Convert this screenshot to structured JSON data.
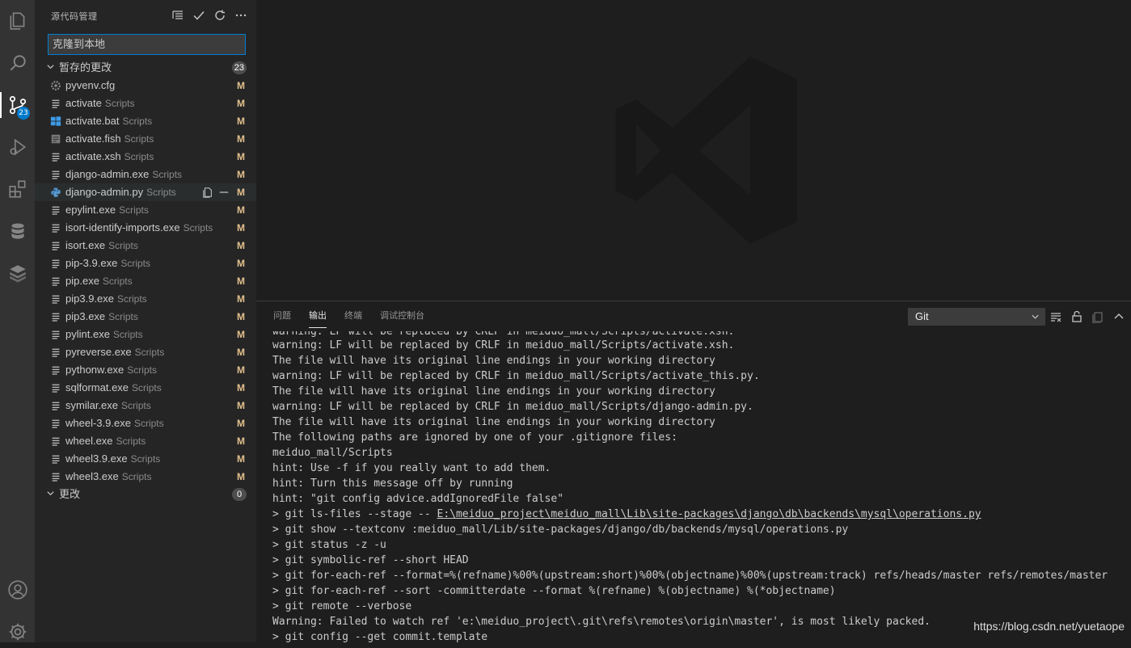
{
  "activity_bar": {
    "items": [
      {
        "name": "explorer-icon"
      },
      {
        "name": "search-icon"
      },
      {
        "name": "source-control-icon",
        "badge": "23"
      },
      {
        "name": "run-debug-icon"
      },
      {
        "name": "extensions-icon"
      },
      {
        "name": "database-icon"
      },
      {
        "name": "layers-icon"
      }
    ],
    "bottom": [
      {
        "name": "account-icon"
      },
      {
        "name": "settings-gear-icon"
      }
    ]
  },
  "sidebar": {
    "title": "源代码管理",
    "commit_message": "克隆到本地",
    "staged_section": {
      "label": "暂存的更改",
      "count": "23"
    },
    "staged_files": [
      {
        "name": "pyvenv.cfg",
        "dir": "",
        "status": "M",
        "icon": "gear"
      },
      {
        "name": "activate",
        "dir": "Scripts",
        "status": "M",
        "icon": "lines"
      },
      {
        "name": "activate.bat",
        "dir": "Scripts",
        "status": "M",
        "icon": "windows"
      },
      {
        "name": "activate.fish",
        "dir": "Scripts",
        "status": "M",
        "icon": "doc"
      },
      {
        "name": "activate.xsh",
        "dir": "Scripts",
        "status": "M",
        "icon": "lines"
      },
      {
        "name": "django-admin.exe",
        "dir": "Scripts",
        "status": "M",
        "icon": "lines"
      },
      {
        "name": "django-admin.py",
        "dir": "Scripts",
        "status": "M",
        "icon": "python"
      },
      {
        "name": "epylint.exe",
        "dir": "Scripts",
        "status": "M",
        "icon": "lines"
      },
      {
        "name": "isort-identify-imports.exe",
        "dir": "Scripts",
        "status": "M",
        "icon": "lines"
      },
      {
        "name": "isort.exe",
        "dir": "Scripts",
        "status": "M",
        "icon": "lines"
      },
      {
        "name": "pip-3.9.exe",
        "dir": "Scripts",
        "status": "M",
        "icon": "lines"
      },
      {
        "name": "pip.exe",
        "dir": "Scripts",
        "status": "M",
        "icon": "lines"
      },
      {
        "name": "pip3.9.exe",
        "dir": "Scripts",
        "status": "M",
        "icon": "lines"
      },
      {
        "name": "pip3.exe",
        "dir": "Scripts",
        "status": "M",
        "icon": "lines"
      },
      {
        "name": "pylint.exe",
        "dir": "Scripts",
        "status": "M",
        "icon": "lines"
      },
      {
        "name": "pyreverse.exe",
        "dir": "Scripts",
        "status": "M",
        "icon": "lines"
      },
      {
        "name": "pythonw.exe",
        "dir": "Scripts",
        "status": "M",
        "icon": "lines"
      },
      {
        "name": "sqlformat.exe",
        "dir": "Scripts",
        "status": "M",
        "icon": "lines"
      },
      {
        "name": "symilar.exe",
        "dir": "Scripts",
        "status": "M",
        "icon": "lines"
      },
      {
        "name": "wheel-3.9.exe",
        "dir": "Scripts",
        "status": "M",
        "icon": "lines"
      },
      {
        "name": "wheel.exe",
        "dir": "Scripts",
        "status": "M",
        "icon": "lines"
      },
      {
        "name": "wheel3.9.exe",
        "dir": "Scripts",
        "status": "M",
        "icon": "lines"
      },
      {
        "name": "wheel3.exe",
        "dir": "Scripts",
        "status": "M",
        "icon": "lines"
      }
    ],
    "hovered_index": 6,
    "changes_section": {
      "label": "更改",
      "count": "0"
    }
  },
  "panel": {
    "tabs": [
      "问题",
      "输出",
      "终端",
      "调试控制台"
    ],
    "active_tab": 1,
    "channel": "Git",
    "output_lines": [
      {
        "text": "warning: LF will be replaced by CRLF in meiduo_mall/Scripts/activate.xsh.",
        "cut": true
      },
      {
        "text": "warning: LF will be replaced by CRLF in meiduo_mall/Scripts/activate.xsh."
      },
      {
        "text": "The file will have its original line endings in your working directory"
      },
      {
        "text": "warning: LF will be replaced by CRLF in meiduo_mall/Scripts/activate_this.py."
      },
      {
        "text": "The file will have its original line endings in your working directory"
      },
      {
        "text": "warning: LF will be replaced by CRLF in meiduo_mall/Scripts/django-admin.py."
      },
      {
        "text": "The file will have its original line endings in your working directory"
      },
      {
        "text": "The following paths are ignored by one of your .gitignore files:"
      },
      {
        "text": "meiduo_mall/Scripts"
      },
      {
        "text": "hint: Use -f if you really want to add them."
      },
      {
        "text": "hint: Turn this message off by running"
      },
      {
        "text": "hint: \"git config advice.addIgnoredFile false\""
      },
      {
        "text": "> git ls-files --stage -- ",
        "link": "E:\\meiduo_project\\meiduo_mall\\Lib\\site-packages\\django\\db\\backends\\mysql\\operations.py"
      },
      {
        "text": "> git show --textconv :meiduo_mall/Lib/site-packages/django/db/backends/mysql/operations.py"
      },
      {
        "text": "> git status -z -u"
      },
      {
        "text": "> git symbolic-ref --short HEAD"
      },
      {
        "text": "> git for-each-ref --format=%(refname)%00%(upstream:short)%00%(objectname)%00%(upstream:track) refs/heads/master refs/remotes/master"
      },
      {
        "text": "> git for-each-ref --sort -committerdate --format %(refname) %(objectname) %(*objectname)"
      },
      {
        "text": "> git remote --verbose"
      },
      {
        "text": "Warning: Failed to watch ref 'e:\\meiduo_project\\.git\\refs\\remotes\\origin\\master', is most likely packed."
      },
      {
        "text": "> git config --get commit.template"
      }
    ]
  },
  "watermark": "https://blog.csdn.net/yuetaope"
}
